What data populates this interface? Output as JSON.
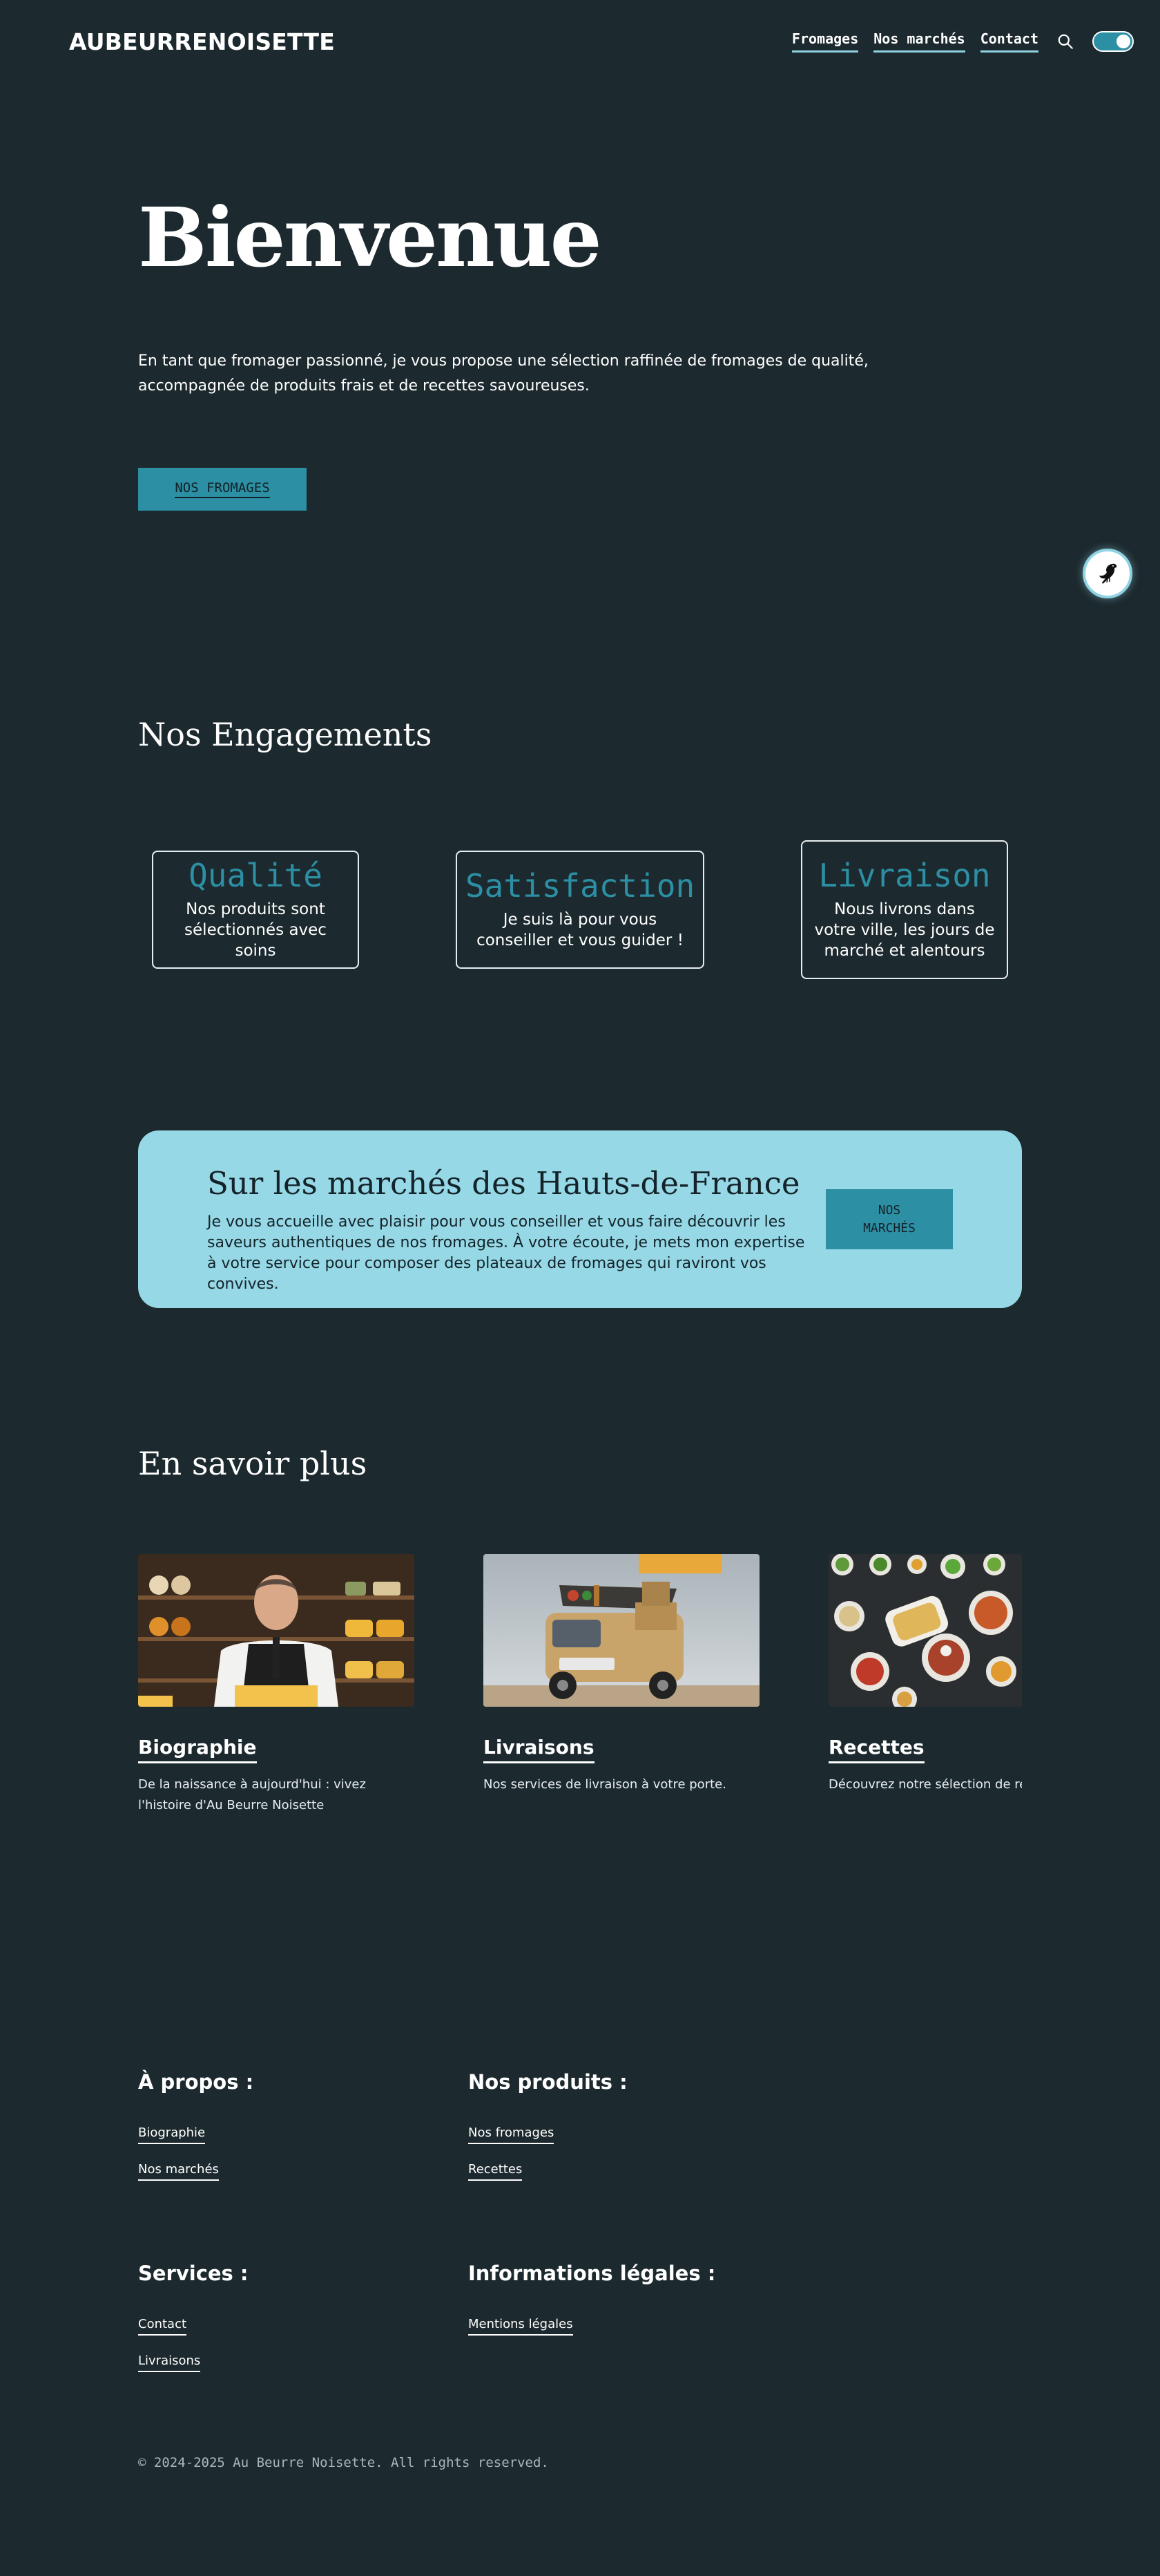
{
  "header": {
    "logo": "AUBEURRENOISETTE",
    "nav": [
      {
        "label": "Fromages"
      },
      {
        "label": "Nos marchés"
      },
      {
        "label": "Contact"
      }
    ],
    "search_icon": "search-icon",
    "theme_toggle": "on"
  },
  "hero": {
    "title": "Bienvenue",
    "text_line1": "En tant que fromager passionné, je vous propose une sélection raffinée de fromages de qualité,",
    "text_line2": "accompagnée de produits frais et de recettes savoureuses.",
    "button": "NOS FROMAGES"
  },
  "floating_button": {
    "icon": "bird-icon"
  },
  "engagements": {
    "title": "Nos Engagements",
    "cards": [
      {
        "title": "Qualité",
        "text": "Nos produits sont sélectionnés avec soins"
      },
      {
        "title": "Satisfaction",
        "text": "Je suis là pour vous conseiller et vous guider !"
      },
      {
        "title": "Livraison",
        "text": "Nous livrons dans votre ville, les jours de marché et alentours"
      }
    ]
  },
  "markets": {
    "title": "Sur les marchés des Hauts-de-France",
    "text": "Je vous accueille avec plaisir pour vous conseiller et vous faire découvrir les saveurs authentiques de nos fromages. À votre écoute, je mets mon expertise à votre service pour composer des plateaux de fromages qui raviront vos convives.",
    "button": "NOS MARCHÉS"
  },
  "learn_more": {
    "title": "En savoir plus",
    "cards": [
      {
        "title": "Biographie",
        "text": "De la naissance à aujourd'hui : vivez l'histoire d'Au Beurre Noisette",
        "image": "cheesemonger-photo"
      },
      {
        "title": "Livraisons",
        "text": "Nos services de livraison à votre porte.",
        "image": "delivery-truck-photo"
      },
      {
        "title": "Recettes",
        "text": "Découvrez notre sélection de rece",
        "image": "dishes-photo"
      }
    ]
  },
  "footer": {
    "about": {
      "title": "À propos :",
      "links": [
        "Biographie",
        "Nos marchés"
      ]
    },
    "products": {
      "title": "Nos produits :",
      "links": [
        "Nos fromages",
        "Recettes"
      ]
    },
    "services": {
      "title": "Services :",
      "links": [
        "Contact",
        "Livraisons"
      ]
    },
    "legal": {
      "title": "Informations légales :",
      "links": [
        "Mentions légales"
      ]
    },
    "copyright": "© 2024-2025 Au Beurre Noisette. All rights reserved."
  },
  "colors": {
    "background": "#1c292e",
    "accent": "#2c8fa3",
    "accent_light": "#96d8e5",
    "text": "#ffffff"
  }
}
